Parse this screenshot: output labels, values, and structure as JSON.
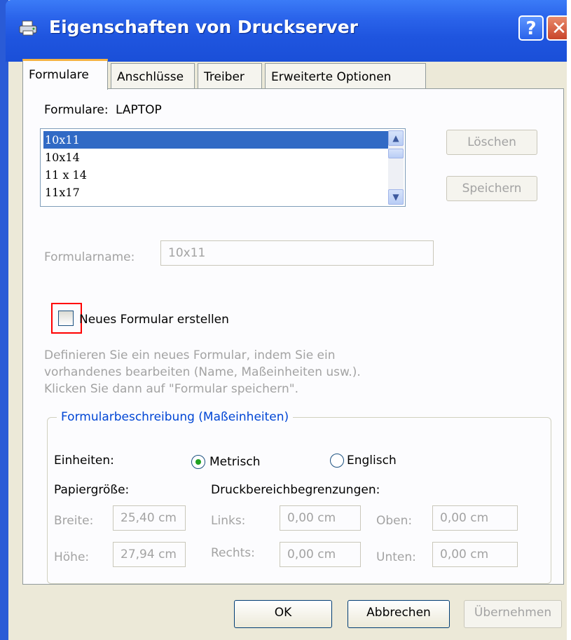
{
  "window": {
    "title": "Eigenschaften von Druckserver",
    "help_glyph": "?",
    "close_glyph": "✕"
  },
  "tabs": [
    {
      "label": "Formulare",
      "active": true
    },
    {
      "label": "Anschlüsse",
      "active": false
    },
    {
      "label": "Treiber",
      "active": false
    },
    {
      "label": "Erweiterte Optionen",
      "active": false
    }
  ],
  "forms": {
    "header_label": "Formulare:",
    "server_name": "LAPTOP",
    "items": [
      "10x11",
      "10x14",
      "11 x 14",
      "11x17"
    ],
    "selected_index": 0,
    "delete_label": "Löschen",
    "save_label": "Speichern",
    "name_label": "Formularname:",
    "name_value": "10x11",
    "create_new_label": "Neues Formular erstellen",
    "create_new_checked": false,
    "help_text": [
      "Definieren Sie ein neues Formular, indem Sie ein",
      "vorhandenes bearbeiten (Name, Maßeinheiten usw.).",
      "Klicken Sie dann auf \"Formular speichern\"."
    ]
  },
  "description": {
    "group_title": "Formularbeschreibung (Maßeinheiten)",
    "units_label": "Einheiten:",
    "metric_label": "Metrisch",
    "english_label": "Englisch",
    "metric_selected": true,
    "paper_size_label": "Papiergröße:",
    "print_area_label": "Druckbereichbegrenzungen:",
    "width_label": "Breite:",
    "width_value": "25,40 cm",
    "height_label": "Höhe:",
    "height_value": "27,94 cm",
    "left_label": "Links:",
    "left_value": "0,00 cm",
    "right_label": "Rechts:",
    "right_value": "0,00 cm",
    "top_label": "Oben:",
    "top_value": "0,00 cm",
    "bottom_label": "Unten:",
    "bottom_value": "0,00 cm"
  },
  "footer": {
    "ok_label": "OK",
    "cancel_label": "Abbrechen",
    "apply_label": "Übernehmen"
  },
  "colors": {
    "titlebar": "#2a63ea",
    "selection": "#316ac5",
    "highlight_box": "#ff0000",
    "group_title": "#0046d5"
  }
}
